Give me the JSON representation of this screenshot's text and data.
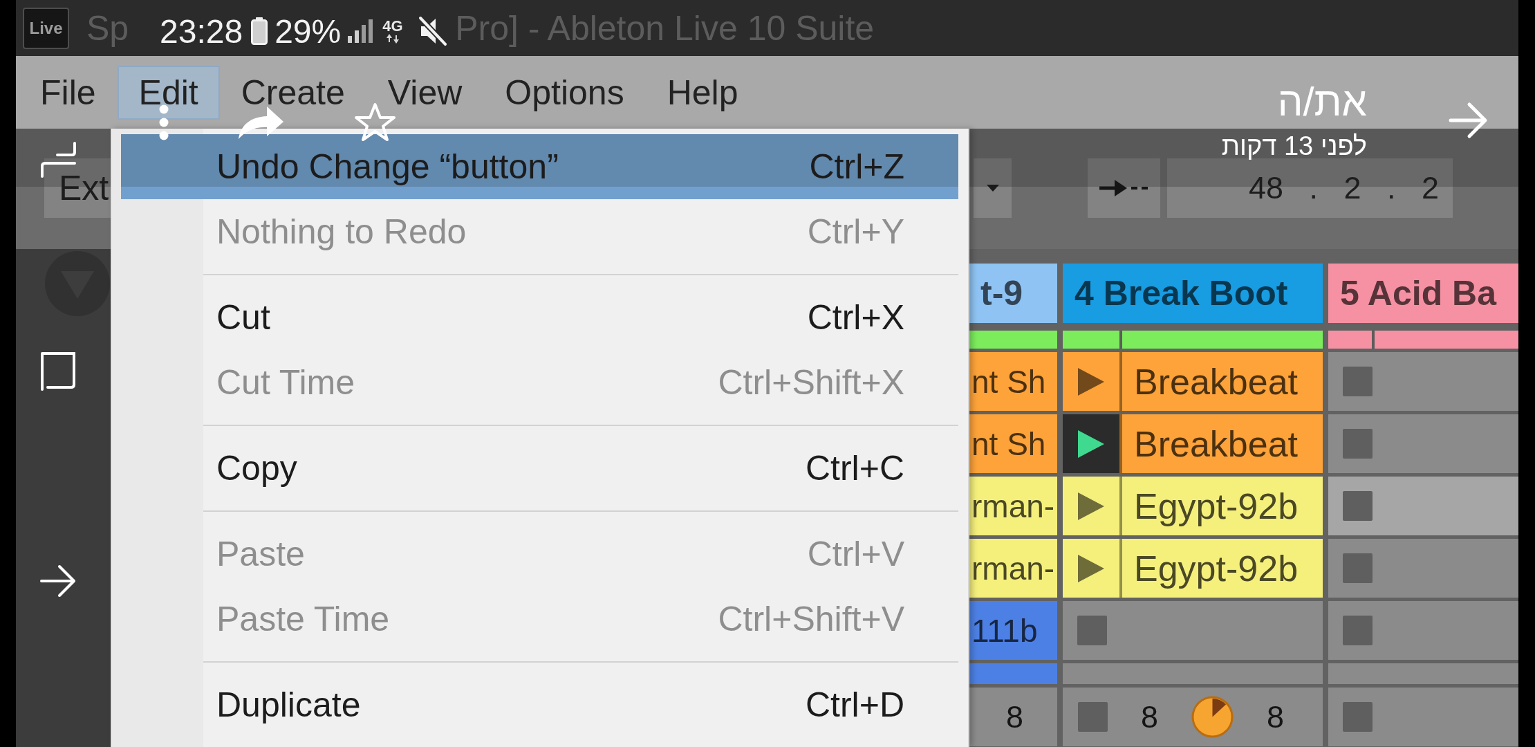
{
  "window": {
    "logo": "Live",
    "title_parts": [
      "Sp",
      "Pro] - Ableton Live 10 Suite"
    ]
  },
  "menu_bar": [
    {
      "label": "File",
      "selected": false
    },
    {
      "label": "Edit",
      "selected": true
    },
    {
      "label": "Create",
      "selected": false
    },
    {
      "label": "View",
      "selected": false
    },
    {
      "label": "Options",
      "selected": false
    },
    {
      "label": "Help",
      "selected": false
    }
  ],
  "edit_menu": [
    {
      "kind": "item",
      "label": "Undo Change “button”",
      "shortcut": "Ctrl+Z",
      "selected": true,
      "disabled": false
    },
    {
      "kind": "item",
      "label": "Nothing to Redo",
      "shortcut": "Ctrl+Y",
      "selected": false,
      "disabled": true
    },
    {
      "kind": "separator"
    },
    {
      "kind": "item",
      "label": "Cut",
      "shortcut": "Ctrl+X",
      "selected": false,
      "disabled": false
    },
    {
      "kind": "item",
      "label": "Cut Time",
      "shortcut": "Ctrl+Shift+X",
      "selected": false,
      "disabled": true
    },
    {
      "kind": "separator"
    },
    {
      "kind": "item",
      "label": "Copy",
      "shortcut": "Ctrl+C",
      "selected": false,
      "disabled": false
    },
    {
      "kind": "separator"
    },
    {
      "kind": "item",
      "label": "Paste",
      "shortcut": "Ctrl+V",
      "selected": false,
      "disabled": true
    },
    {
      "kind": "item",
      "label": "Paste Time",
      "shortcut": "Ctrl+Shift+V",
      "selected": false,
      "disabled": true
    },
    {
      "kind": "separator"
    },
    {
      "kind": "item",
      "label": "Duplicate",
      "shortcut": "Ctrl+D",
      "selected": false,
      "disabled": false
    }
  ],
  "transport": {
    "sync_button": "Ext",
    "position": "48 . 2 . 2"
  },
  "session": {
    "tracks": [
      {
        "title": "t-9",
        "color": "#8ec3f3",
        "playing": true
      },
      {
        "title": "4 Break Boot",
        "color": "#189ce2",
        "playing": true
      },
      {
        "title": "5 Acid Ba",
        "color": "#f591a3",
        "playing": false
      }
    ],
    "scenes": [
      {
        "selected": false,
        "slots": [
          {
            "kind": "clip_end",
            "name": "nt Sh",
            "color": "#fda33a"
          },
          {
            "kind": "clip",
            "name": "Breakbeat",
            "color": "#fda33a",
            "playing": false
          },
          {
            "kind": "empty"
          }
        ]
      },
      {
        "selected": false,
        "slots": [
          {
            "kind": "clip_end",
            "name": "nt Sh",
            "color": "#fda33a"
          },
          {
            "kind": "clip",
            "name": "Breakbeat",
            "color": "#fda33a",
            "playing": true
          },
          {
            "kind": "empty"
          }
        ]
      },
      {
        "selected": true,
        "slots": [
          {
            "kind": "clip_end",
            "name": "rman-",
            "color": "#f5f07c"
          },
          {
            "kind": "clip",
            "name": "Egypt-92b",
            "color": "#f5f07c",
            "playing": false
          },
          {
            "kind": "empty"
          }
        ]
      },
      {
        "selected": false,
        "slots": [
          {
            "kind": "clip_end",
            "name": "rman-",
            "color": "#f5f07c"
          },
          {
            "kind": "clip",
            "name": "Egypt-92b",
            "color": "#f5f07c",
            "playing": false
          },
          {
            "kind": "empty"
          }
        ]
      },
      {
        "selected": false,
        "slots": [
          {
            "kind": "clip_end",
            "name": "111b",
            "color": "#4d80e4"
          },
          {
            "kind": "empty"
          },
          {
            "kind": "empty"
          }
        ]
      },
      {
        "selected": false,
        "slots": [
          {
            "kind": "stub",
            "color": "#4d80e4"
          },
          {
            "kind": "stub"
          },
          {
            "kind": "stub"
          }
        ]
      }
    ],
    "footer": [
      {
        "items": [
          {
            "kind": "text",
            "text": "8"
          }
        ]
      },
      {
        "items": [
          {
            "kind": "stop"
          },
          {
            "kind": "text",
            "text": "8"
          },
          {
            "kind": "pie"
          },
          {
            "kind": "text",
            "text": "8"
          }
        ]
      },
      {
        "items": [
          {
            "kind": "stop"
          }
        ]
      }
    ]
  },
  "viewer": {
    "clock": "23:28",
    "battery": "29%",
    "network": "4G",
    "sender": "את/ה",
    "sent_time": "לפני 13 דקות"
  }
}
